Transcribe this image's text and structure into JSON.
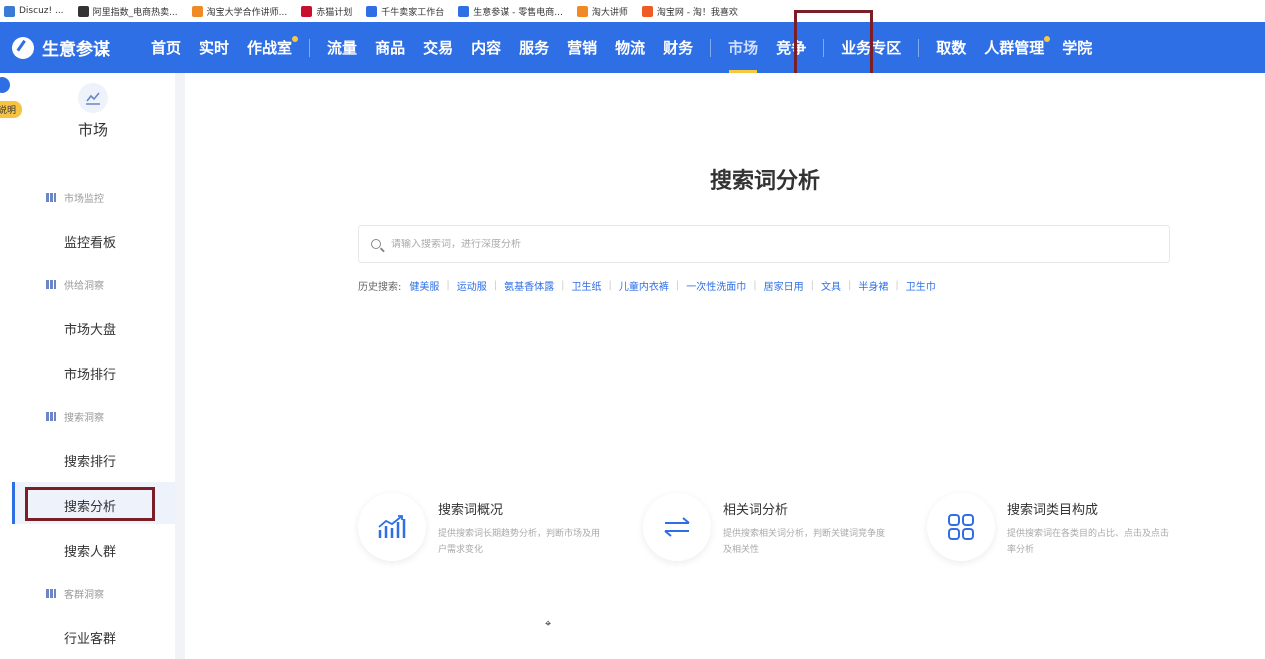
{
  "bookmarks": [
    {
      "label": "Discuz! ...",
      "color": "#3a7bd5"
    },
    {
      "label": "阿里指数_电商热卖...",
      "color": "#333333"
    },
    {
      "label": "淘宝大学合作讲师...",
      "color": "#f08a24"
    },
    {
      "label": "赤猫计划",
      "color": "#c8102e"
    },
    {
      "label": "千牛卖家工作台",
      "color": "#2f6fe6"
    },
    {
      "label": "生意参谋 - 零售电商...",
      "color": "#2f6fe6"
    },
    {
      "label": "淘大讲师",
      "color": "#f08a24"
    },
    {
      "label": "淘宝网 - 淘！我喜欢",
      "color": "#f05a24"
    }
  ],
  "topnav": {
    "brand": "生意参谋",
    "items": [
      {
        "label": "首页"
      },
      {
        "label": "实时"
      },
      {
        "label": "作战室",
        "dot": true
      },
      {
        "sep": true
      },
      {
        "label": "流量"
      },
      {
        "label": "商品"
      },
      {
        "label": "交易"
      },
      {
        "label": "内容"
      },
      {
        "label": "服务"
      },
      {
        "label": "营销"
      },
      {
        "label": "物流"
      },
      {
        "label": "财务"
      },
      {
        "sep": true
      },
      {
        "label": "市场",
        "active": true
      },
      {
        "label": "竞争"
      },
      {
        "sep": true
      },
      {
        "label": "业务专区"
      },
      {
        "sep": true
      },
      {
        "label": "取数"
      },
      {
        "label": "人群管理",
        "dot": true
      },
      {
        "label": "学院"
      }
    ]
  },
  "sidebar": {
    "header": "市场",
    "help_tag": "说明",
    "groups": [
      {
        "label": "市场监控",
        "items": [
          "监控看板"
        ]
      },
      {
        "label": "供给洞察",
        "items": [
          "市场大盘",
          "市场排行"
        ]
      },
      {
        "label": "搜索洞察",
        "items": [
          "搜索排行",
          "搜索分析",
          "搜索人群"
        ]
      },
      {
        "label": "客群洞察",
        "items": [
          "行业客群"
        ]
      }
    ],
    "active_item": "搜索分析"
  },
  "main": {
    "title": "搜索词分析",
    "search_placeholder": "请输入搜索词，进行深度分析",
    "history_label": "历史搜索:",
    "history": [
      "健美服",
      "运动服",
      "氨基香体露",
      "卫生纸",
      "儿童内衣裤",
      "一次性洗面巾",
      "居家日用",
      "文具",
      "半身裙",
      "卫生巾"
    ],
    "cards": [
      {
        "title": "搜索词概况",
        "desc": "提供搜索词长期趋势分析，判断市场及用户需求变化",
        "icon": "trend-chart-icon"
      },
      {
        "title": "相关词分析",
        "desc": "提供搜索相关词分析，判断关键词竞争度及相关性",
        "icon": "swap-arrows-icon"
      },
      {
        "title": "搜索词类目构成",
        "desc": "提供搜索词在各类目的占比、点击及点击率分析",
        "icon": "grid-squares-icon"
      }
    ]
  }
}
